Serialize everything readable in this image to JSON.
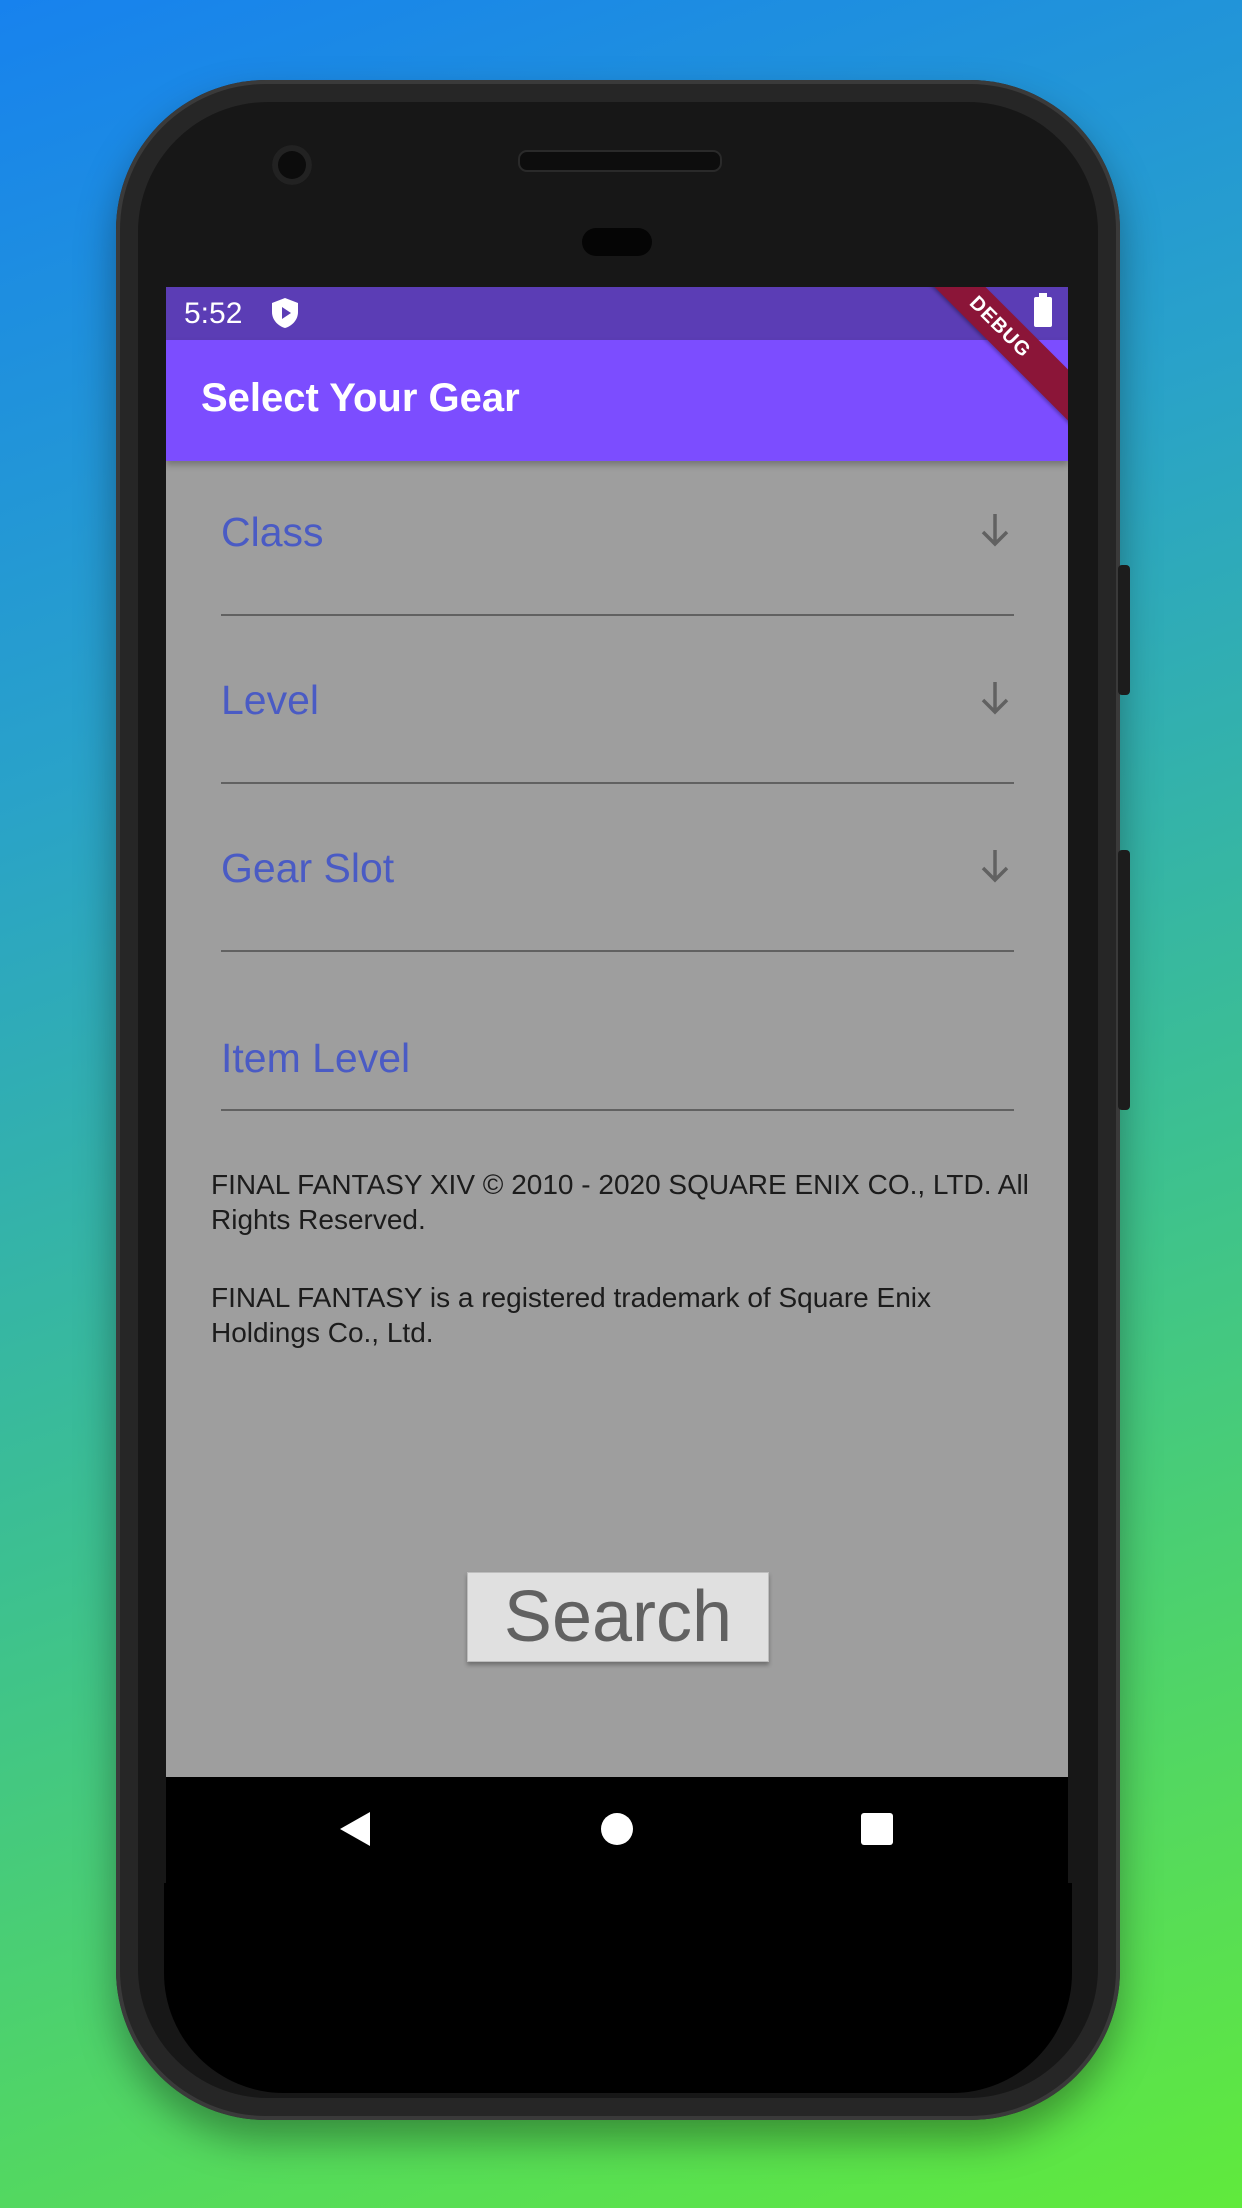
{
  "status_bar": {
    "time": "5:52"
  },
  "app_bar": {
    "title": "Select Your Gear",
    "debug_label": "DEBUG"
  },
  "form": {
    "class_label": "Class",
    "level_label": "Level",
    "gear_slot_label": "Gear Slot",
    "item_level_label": "Item Level"
  },
  "footer": {
    "copyright": "FINAL FANTASY XIV © 2010 - 2020 SQUARE ENIX CO., LTD. All Rights Reserved.",
    "trademark": "FINAL FANTASY is a registered trademark of Square Enix Holdings Co., Ltd."
  },
  "search_button": {
    "label": "Search"
  },
  "icons": {
    "class_dropdown": "arrow-down-icon",
    "level_dropdown": "arrow-down-icon",
    "gear_slot_dropdown": "arrow-down-icon",
    "nav_back": "back-triangle-icon",
    "nav_home": "home-circle-icon",
    "nav_recents": "recents-square-icon"
  },
  "colors": {
    "app_bar": "#7c4dff",
    "status_bar": "#5b3db5",
    "label_text": "#4a5bc4",
    "screen_bg": "#9e9e9e",
    "debug_banner": "#8b1538"
  }
}
